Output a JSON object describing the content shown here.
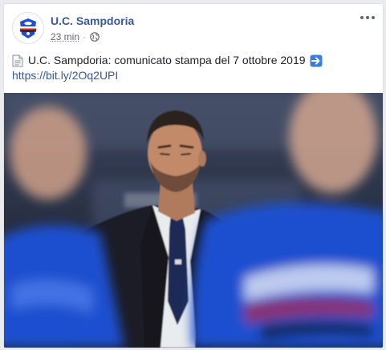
{
  "post": {
    "page_name": "U.C. Sampdoria",
    "timestamp": "23 min",
    "separator": "·",
    "privacy_icon": "globe-icon",
    "more_icon": "more-options-icon",
    "text_prefix_icon": "document-icon",
    "text": "U.C. Sampdoria: comunicato stampa del 7 ottobre 2019",
    "text_suffix_icon": "right-arrow-emoji-icon",
    "link": "https://bit.ly/2Oq2UPI"
  },
  "colors": {
    "page_background": "#e9ebee",
    "name_link": "#385898",
    "meta_text": "#616770",
    "body_text": "#1d2129",
    "jersey_blue": "#1f4fcf",
    "arrow_emoji": "#3b7ddd"
  }
}
